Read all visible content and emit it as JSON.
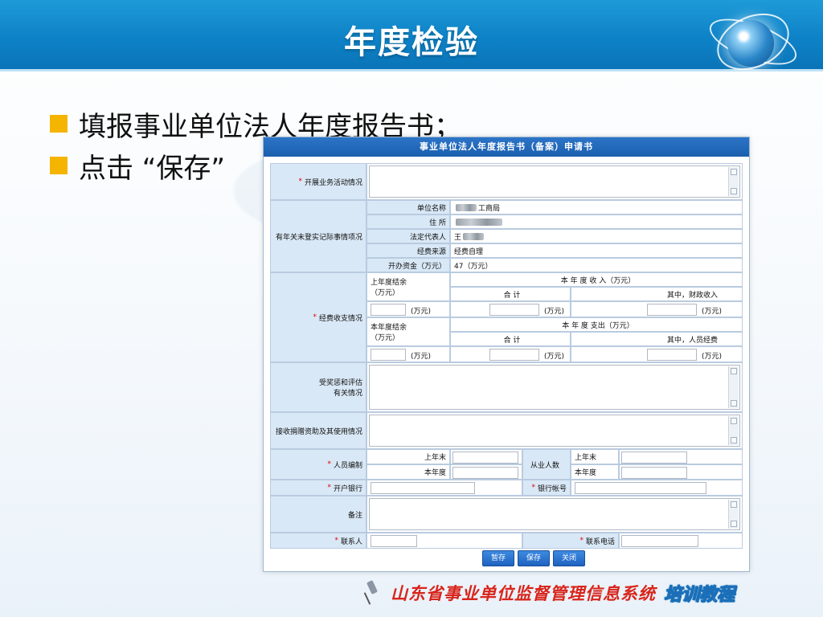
{
  "slide": {
    "title": "年度检验"
  },
  "bullets": [
    "填报事业单位法人年度报告书；",
    "点击 “保存”"
  ],
  "form": {
    "title": "事业单位法人年度报告书（备案）申请书",
    "business_label": "开展业务活动情况",
    "change_label": "有年关末登实记际事情项况",
    "unit_name_label": "单位名称",
    "unit_name_value": "工商局",
    "address_label": "住    所",
    "legal_rep_label": "法定代表人",
    "legal_rep_value": "王",
    "fund_source_label": "经费来源",
    "fund_source_value": "经费自理",
    "capital_label": "开办资金（万元）",
    "capital_value": "47（万元）",
    "finance_label": "经费收支情况",
    "prev_balance_label": "上年度结余（万元）",
    "income_header": "本 年 度 收 入（万元）",
    "total_label": "合    计",
    "income_fiscal_label": "其中，财政收入",
    "unit_wan": "(万元)",
    "curr_balance_label": "本年度结余（万元）",
    "expense_header": "本 年 度 支出（万元）",
    "expense_staff_label": "其中，人员经费",
    "awards_label": "受奖惩和评估有关情况",
    "donation_label": "接收捐赠资助及其使用情况",
    "staffing_label": "人员编制",
    "last_year_end": "上年末",
    "this_year": "本年度",
    "employees_label": "从业人数",
    "bank_label": "开户银行",
    "account_label": "银行帐号",
    "remark_label": "备注",
    "contact_label": "联系人",
    "phone_label": "联系电话",
    "required_mark": "*",
    "btn_temp": "暂存",
    "btn_save": "保存",
    "btn_close": "关闭"
  },
  "footer": {
    "main": "山东省事业单位监督管理信息系统",
    "tag": "培训教程"
  },
  "colors": {
    "header_blue": "#0e82c7",
    "bullet_yellow": "#f5b400",
    "footer_red": "#d9241b",
    "label_bg": "#d9e8f6"
  }
}
